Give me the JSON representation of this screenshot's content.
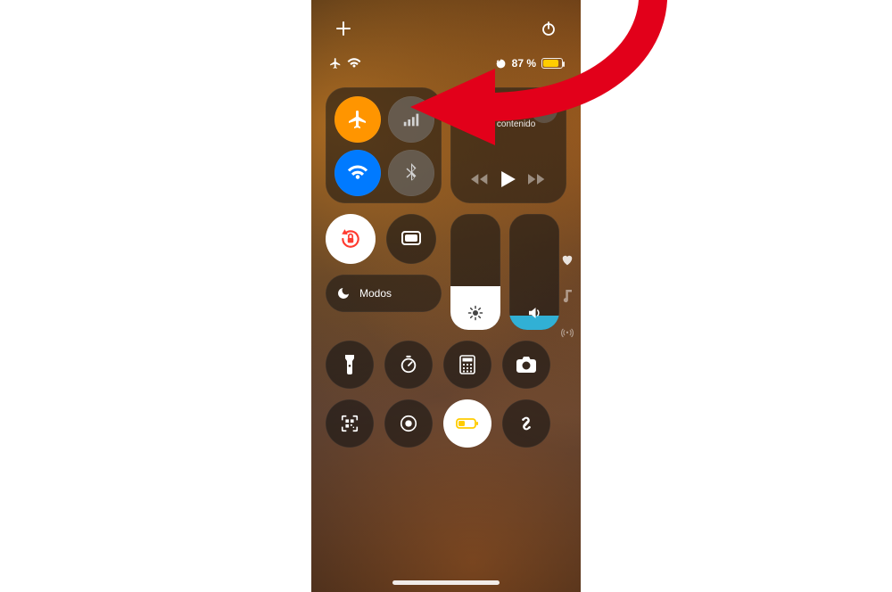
{
  "topbar": {
    "plus": "+",
    "power": "power"
  },
  "status": {
    "battery_text": "87 %",
    "battery_fill_pct": 87
  },
  "connectivity": {
    "airplane_active": true,
    "wifi_active": true,
    "cellular_active": false,
    "bluetooth_active": false,
    "airdrop_active": false,
    "hotspot_active": false
  },
  "media": {
    "status_text": "Sin contenido"
  },
  "orientation_lock": {
    "locked": true
  },
  "focus": {
    "label": "Modos"
  },
  "sliders": {
    "brightness_pct": 38,
    "volume_pct": 12
  },
  "accent": {
    "orange": "#ff9500",
    "blue": "#007aff",
    "yellow": "#ffcc00",
    "red": "#ff3b30"
  }
}
